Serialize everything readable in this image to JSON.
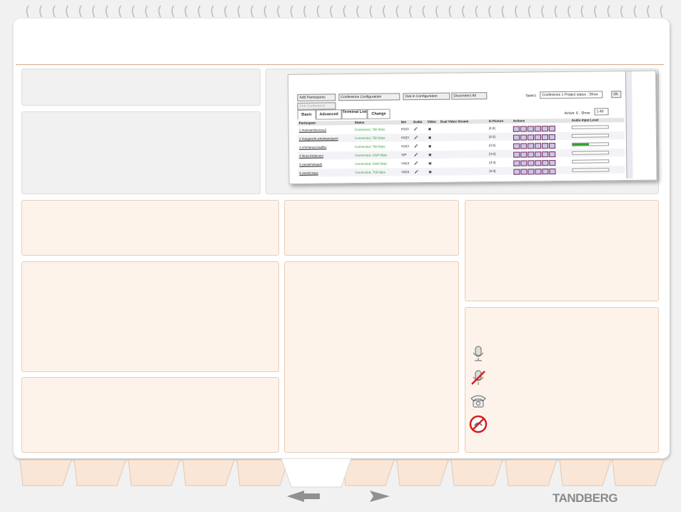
{
  "brand": "TANDBERG",
  "nav": {
    "prev_label": "previous",
    "next_label": "next"
  },
  "conference_screenshot": {
    "buttons": [
      "Add Participants",
      "Conference Configuration",
      "Dial-in Configuration",
      "Disconnect All",
      "End Conference"
    ],
    "select_label": "Select:",
    "select_value": "Conference 1 Project status : Show",
    "ok_label": "Ok",
    "tabs": [
      "Basic",
      "Advanced",
      "Terminal List",
      "Change"
    ],
    "active_label": "Active: 6 , Show",
    "show_value": "1-40",
    "columns": [
      "Participant",
      "Status",
      "Net",
      "Audio",
      "Video",
      "Dual Video Stream",
      "In Picture",
      "Actions",
      "Audio Input Level"
    ],
    "rows": [
      {
        "participant": "1 marisamilovicos2",
        "status": "Connected, 768 kbps",
        "net": "H323",
        "layout": "[4:3]",
        "level": 0
      },
      {
        "participant": "2 margareth.windmanstorm",
        "status": "Connected, 768 kbps",
        "net": "H323",
        "layout": "[4:3]",
        "level": 0
      },
      {
        "participant": "3 emmanuel.lauffer",
        "status": "Connected, 768 kbps",
        "net": "H323",
        "layout": "[4:3]",
        "level": 0.45
      },
      {
        "participant": "4 Nora Andersen",
        "status": "Connected, 1920 kbps",
        "net": "SIP",
        "layout": "[4:3]",
        "level": 0
      },
      {
        "participant": "5 paulamukaark",
        "status": "Connected, 1920 kbps",
        "net": "H323",
        "layout": "[4:3]",
        "level": 0
      },
      {
        "participant": "6 austin.kass",
        "status": "Connected, 768 kbps",
        "net": "H323",
        "layout": "[4:3]",
        "level": 0
      }
    ]
  },
  "legend": [
    "microphone-icon",
    "microphone-muted-icon",
    "telephone-icon",
    "no-audio-icon"
  ]
}
